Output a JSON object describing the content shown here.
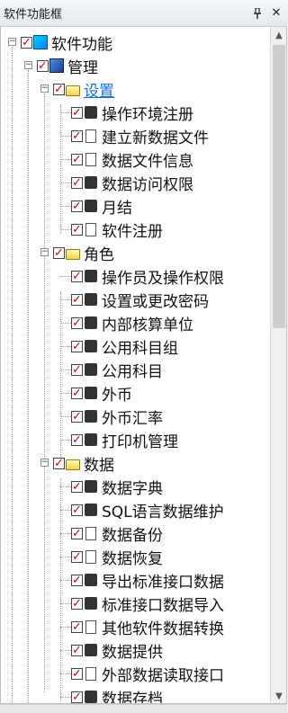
{
  "panel": {
    "title": "软件功能框",
    "pin_icon": "pin-icon",
    "close_icon": "close-icon"
  },
  "scroll_fraction": 0.42,
  "tree": {
    "root": {
      "label": "软件功能",
      "icon": "app-icon"
    },
    "manage": {
      "label": "管理",
      "icon": "manage-icon"
    },
    "settings": {
      "label": "设置",
      "items": [
        {
          "label": "操作环境注册",
          "icon": "gear-icon"
        },
        {
          "label": "建立新数据文件",
          "icon": "new-file-icon"
        },
        {
          "label": "数据文件信息",
          "icon": "file-info-icon"
        },
        {
          "label": "数据访问权限",
          "icon": "key-icon"
        },
        {
          "label": "月结",
          "icon": "lock-icon"
        },
        {
          "label": "软件注册",
          "icon": "register-icon"
        }
      ]
    },
    "roles": {
      "label": "角色",
      "items": [
        {
          "label": "操作员及操作权限",
          "icon": "operator-icon"
        },
        {
          "label": "设置或更改密码",
          "icon": "password-icon"
        },
        {
          "label": "内部核算单位",
          "icon": "home-icon"
        },
        {
          "label": "公用科目组",
          "icon": "account-group-icon"
        },
        {
          "label": "公用科目",
          "icon": "account-icon"
        },
        {
          "label": "外币",
          "icon": "currency-icon"
        },
        {
          "label": "外币汇率",
          "icon": "exchange-rate-icon"
        },
        {
          "label": "打印机管理",
          "icon": "printer-icon"
        }
      ]
    },
    "data": {
      "label": "数据",
      "items": [
        {
          "label": "数据字典",
          "icon": "dictionary-icon"
        },
        {
          "label": "SQL语言数据维护",
          "icon": "sql-icon"
        },
        {
          "label": "数据备份",
          "icon": "backup-icon"
        },
        {
          "label": "数据恢复",
          "icon": "restore-icon"
        },
        {
          "label": "导出标准接口数据",
          "icon": "export-icon"
        },
        {
          "label": "标准接口数据导入",
          "icon": "import-icon"
        },
        {
          "label": "其他软件数据转换",
          "icon": "convert-icon"
        },
        {
          "label": "数据提供",
          "icon": "provide-icon"
        },
        {
          "label": "外部数据读取接口",
          "icon": "external-read-icon"
        },
        {
          "label": "数据存档",
          "icon": "archive-icon"
        }
      ]
    }
  }
}
